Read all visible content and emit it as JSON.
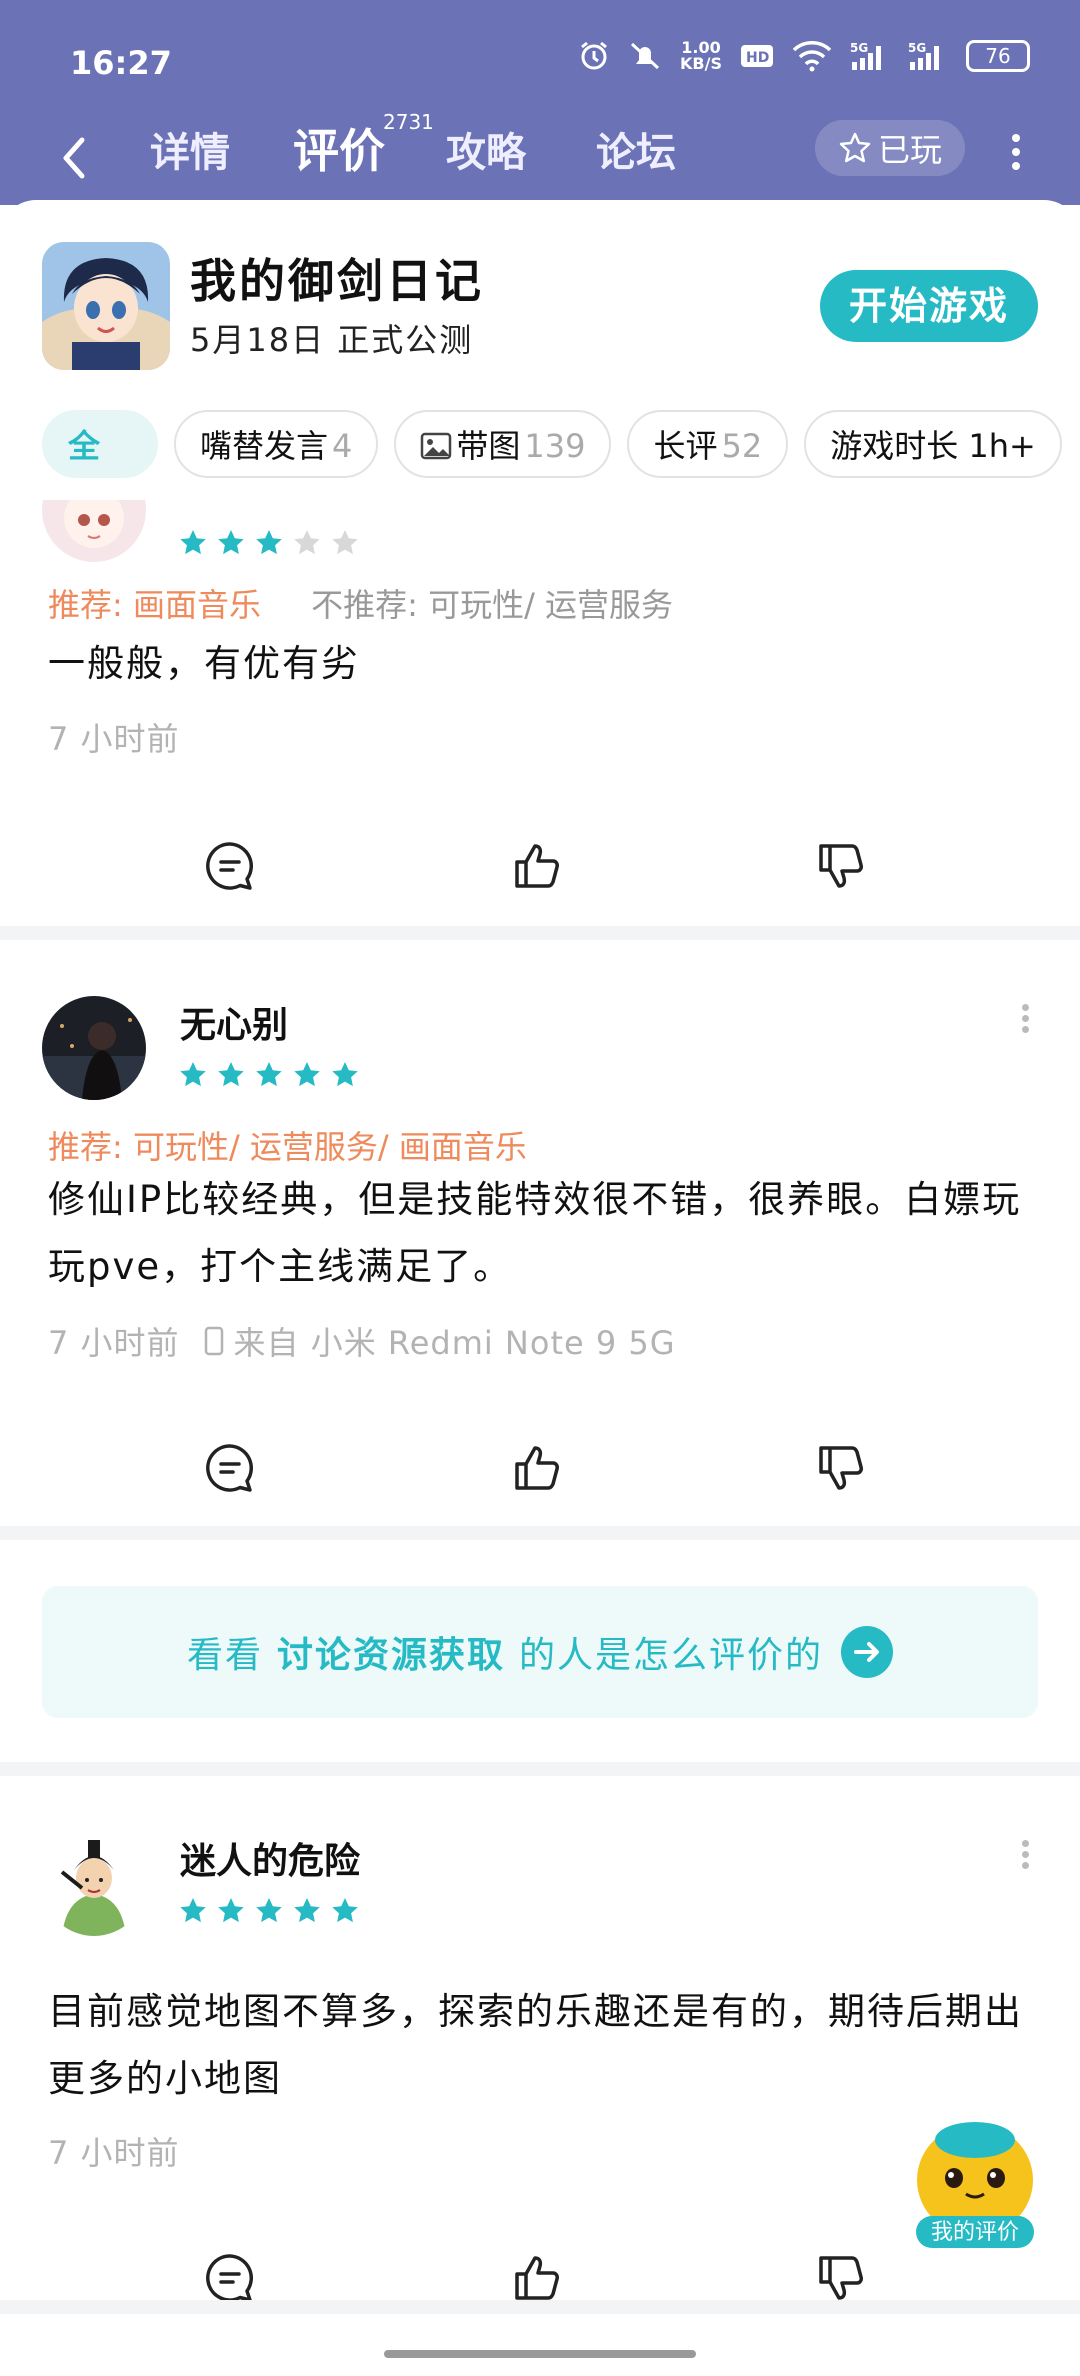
{
  "status_bar": {
    "time": "16:27",
    "net_speed_value": "1.00",
    "net_speed_unit": "KB/S",
    "battery": "76"
  },
  "nav": {
    "tabs": [
      {
        "label": "详情"
      },
      {
        "label": "评价",
        "count": "2731"
      },
      {
        "label": "攻略"
      },
      {
        "label": "论坛"
      }
    ],
    "played_label": "已玩"
  },
  "game": {
    "title": "我的御剑日记",
    "subtitle": "5月18日  正式公测",
    "start_label": "开始游戏"
  },
  "filters": [
    {
      "label": "全",
      "count": ""
    },
    {
      "label": "嘴替发言",
      "count": "4"
    },
    {
      "label": "带图",
      "count": "139"
    },
    {
      "label": "长评",
      "count": "52"
    },
    {
      "label": "游戏时长 1h+",
      "count": ""
    }
  ],
  "reviews": [
    {
      "stars": 3,
      "recommend": "推荐: 画面音乐",
      "not_recommend": "不推荐: 可玩性/ 运营服务",
      "text": "一般般，有优有劣",
      "time": "7 小时前"
    },
    {
      "name": "无心别",
      "stars": 5,
      "recommend": "推荐: 可玩性/ 运营服务/ 画面音乐",
      "text": "修仙IP比较经典，但是技能特效很不错，很养眼。白嫖玩玩pve，打个主线满足了。",
      "time": "7 小时前",
      "device": "来自 小米 Redmi Note 9 5G"
    },
    {
      "name": "迷人的危险",
      "stars": 5,
      "text": "目前感觉地图不算多，探索的乐趣还是有的，期待后期出更多的小地图",
      "time": "7 小时前"
    }
  ],
  "banner": {
    "prefix": "看看",
    "highlight": "讨论资源获取",
    "suffix": "的人是怎么评价的"
  },
  "my_review_label": "我的评价",
  "colors": {
    "header": "#6b72b5",
    "accent": "#25bac4",
    "recommend": "#ee8a5b",
    "star_off": "#d8d8d8"
  }
}
